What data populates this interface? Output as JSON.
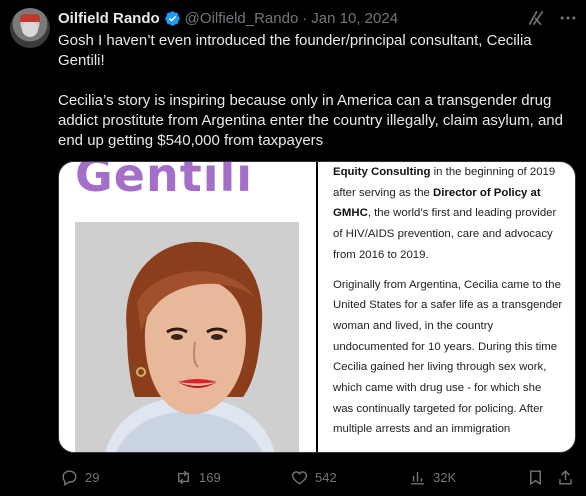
{
  "tweet": {
    "author_name": "Oilfield Rando",
    "handle": "@Oilfield_Rando",
    "separator": "·",
    "date": "Jan 10, 2024",
    "paragraph_1": "Gosh I haven’t even introduced the founder/principal consultant, Cecilia Gentili!",
    "paragraph_2": "Cecilia’s story is inspiring because only in America can a transgender drug addict prostitute from Argentina enter the country illegally, claim asylum, and end up getting $540,000 from taxpayers"
  },
  "media": {
    "heading": "Gentili",
    "bio_1_pre": "Equity Consulting",
    "bio_1_a": " in the beginning of 2019 after serving as the ",
    "bio_1_strong": "Director of Policy at GMHC",
    "bio_1_b": ", the world’s first and leading provider of HIV/AIDS prevention, care and advocacy from 2016 to 2019.",
    "bio_2": "Originally from Argentina, Cecilia came to the United States for a safer life as a transgender woman and lived, in the country undocumented for 10 years. During this time Cecilia gained her living through sex work, which came with drug use - for which she was continually targeted for policing.  After multiple arrests and an immigration"
  },
  "actions": {
    "replies": "29",
    "reposts": "169",
    "likes": "542",
    "views": "32K"
  },
  "colors": {
    "background": "#000000",
    "text": "#e7e9ea",
    "muted": "#71767b",
    "verified": "#1d9bf0",
    "heading_purple": "#a46fc8"
  }
}
